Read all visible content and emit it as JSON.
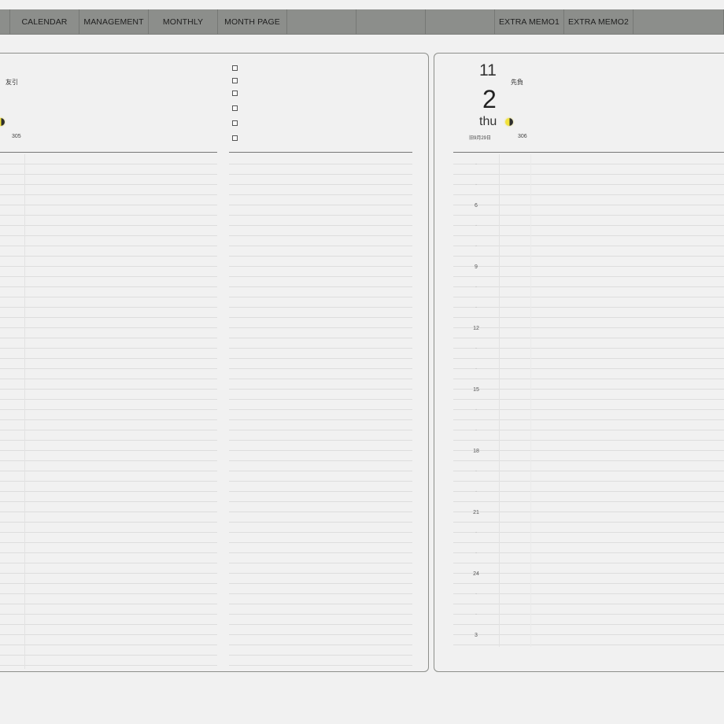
{
  "nav": {
    "tabs": [
      "CALENDAR",
      "MANAGEMENT",
      "MONTHLY",
      "MONTH PAGE"
    ],
    "extra": [
      "EXTRA MEMO1",
      "EXTRA MEMO2"
    ]
  },
  "left_page": {
    "rokuyo": "友引",
    "day_of_year": "305",
    "checkbox_count": 6
  },
  "right_page": {
    "month": "11",
    "day": "2",
    "weekday": "thu",
    "rokuyo": "先負",
    "lunar_date": "旧9月29日",
    "day_of_year": "306",
    "hours": [
      "",
      "",
      "6",
      "",
      "",
      "9",
      "",
      "",
      "12",
      "",
      "",
      "15",
      "",
      "",
      "18",
      "",
      "",
      "21",
      "",
      "",
      "24",
      "",
      "",
      "3"
    ]
  },
  "colors": {
    "nav_bar": "#8c8e8b",
    "background": "#f1f1f1",
    "moon_yellow": "#f2e23a"
  }
}
